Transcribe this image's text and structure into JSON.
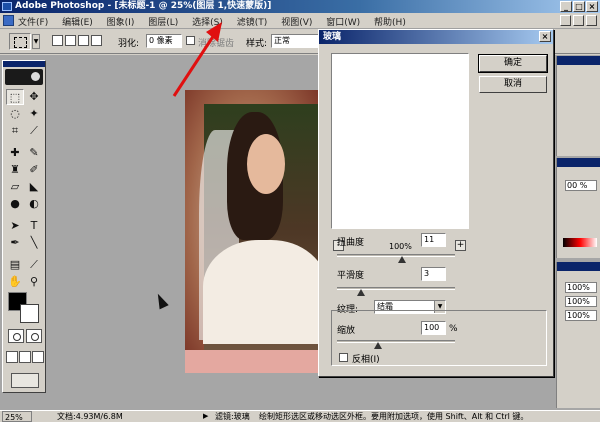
{
  "window": {
    "title": "Adobe Photoshop - [未标题-1 @ 25%(图层 1,快速蒙版)]",
    "min_glyph": "_",
    "max_glyph": "□",
    "close_glyph": "×"
  },
  "menu": {
    "items": [
      "文件(F)",
      "编辑(E)",
      "图象(I)",
      "图层(L)",
      "选择(S)",
      "滤镜(T)",
      "视图(V)",
      "窗口(W)",
      "帮助(H)"
    ]
  },
  "options": {
    "feather_label": "羽化:",
    "feather_value": "0 像素",
    "antialias_label": "消除锯齿",
    "style_label": "样式:",
    "style_value": "正常"
  },
  "dialog": {
    "title": "玻璃",
    "close_glyph": "×",
    "ok_label": "确定",
    "cancel_label": "取消",
    "zoom_minus": "-",
    "zoom_plus": "+",
    "zoom_level": "100%",
    "distortion_label": "扭曲度",
    "distortion_value": "11",
    "distortion_fraction": 0.55,
    "smoothness_label": "平滑度",
    "smoothness_value": "3",
    "smoothness_fraction": 0.2,
    "texture_label": "纹理:",
    "texture_value": "结霜",
    "scaling_label": "缩放",
    "scaling_value": "100",
    "scaling_unit": "%",
    "scaling_fraction": 0.35,
    "invert_label": "反相(I)"
  },
  "panels": {
    "rows": [
      "00 %",
      "100%",
      "100%",
      "100%"
    ]
  },
  "status": {
    "zoom": "25%",
    "doc_size": "文档:4.93M/6.8M",
    "tool": "滤镜:玻璃",
    "hint": "绘制矩形选区或移动选区外框。要用附加选项，使用 Shift、Alt 和 Ctrl 键。"
  },
  "colors": {
    "title_bar": "#0a246a",
    "face": "#d4d0c8",
    "workspace": "#a6a6a6",
    "annotation": "#e01010"
  }
}
